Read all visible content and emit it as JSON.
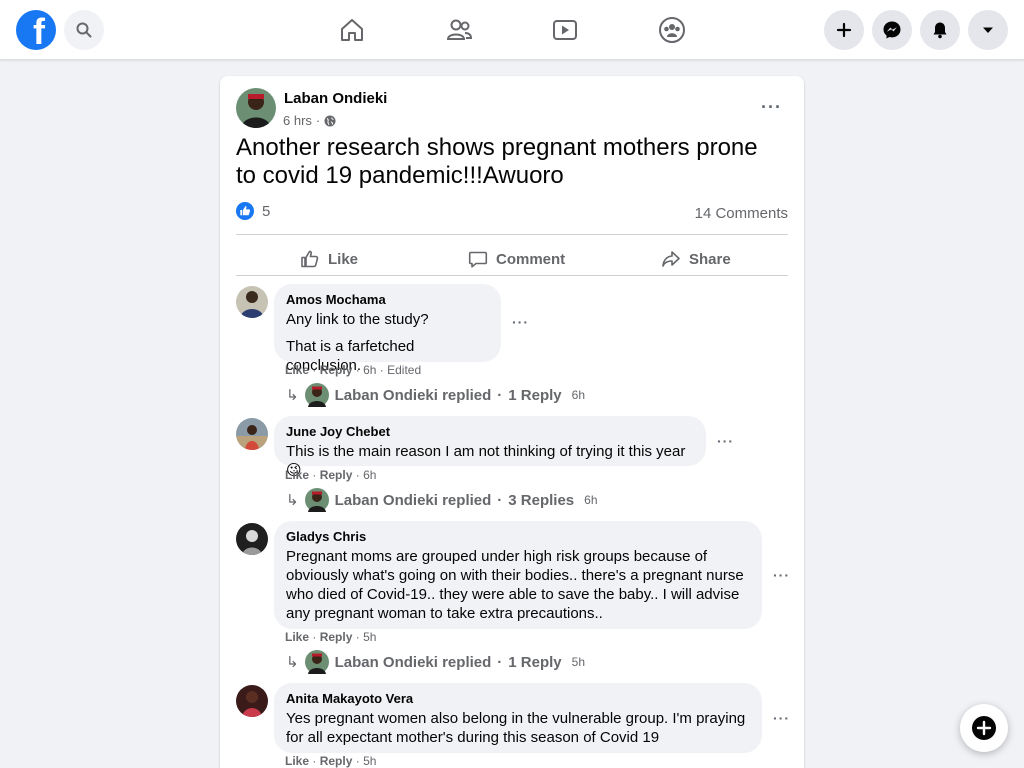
{
  "brand": {
    "logo_letter": "f",
    "color": "#1877f2"
  },
  "post": {
    "author": "Laban Ondieki",
    "time": "6 hrs",
    "privacy_icon": "globe-icon",
    "text": "Another research shows pregnant mothers prone to covid 19 pandemic!!!Awuoro",
    "reaction_count": "5",
    "comments_count": "14 Comments",
    "actions": {
      "like": "Like",
      "comment": "Comment",
      "share": "Share"
    }
  },
  "comments": [
    {
      "name": "Amos Mochama",
      "lines": [
        "Any link to the study?",
        "That is a farfetched conclusion."
      ],
      "like": "Like",
      "reply": "Reply",
      "time": "6h",
      "edited": "Edited",
      "replied_by": "Laban Ondieki replied",
      "replies": "1 Reply",
      "replies_time": "6h"
    },
    {
      "name": "June Joy Chebet",
      "text": "This is the main reason I am not thinking of trying it this year 😉",
      "like": "Like",
      "reply": "Reply",
      "time": "6h",
      "replied_by": "Laban Ondieki replied",
      "replies": "3 Replies",
      "replies_time": "6h"
    },
    {
      "name": "Gladys Chris",
      "text": "Pregnant moms are grouped under high risk groups because of obviously what's going on with their bodies.. there's a pregnant nurse who died of Covid-19.. they were able to save the baby.. I will advise any pregnant woman to take extra precautions..",
      "like": "Like",
      "reply": "Reply",
      "time": "5h",
      "replied_by": "Laban Ondieki replied",
      "replies": "1 Reply",
      "replies_time": "5h"
    },
    {
      "name": "Anita Makayoto Vera",
      "text": "Yes pregnant women also belong in the vulnerable group. I'm praying for all expectant mother's during this season of Covid 19",
      "like": "Like",
      "reply": "Reply",
      "time": "5h"
    }
  ],
  "ui": {
    "separator": "·",
    "more": "···",
    "reply_arrow": "↳"
  }
}
